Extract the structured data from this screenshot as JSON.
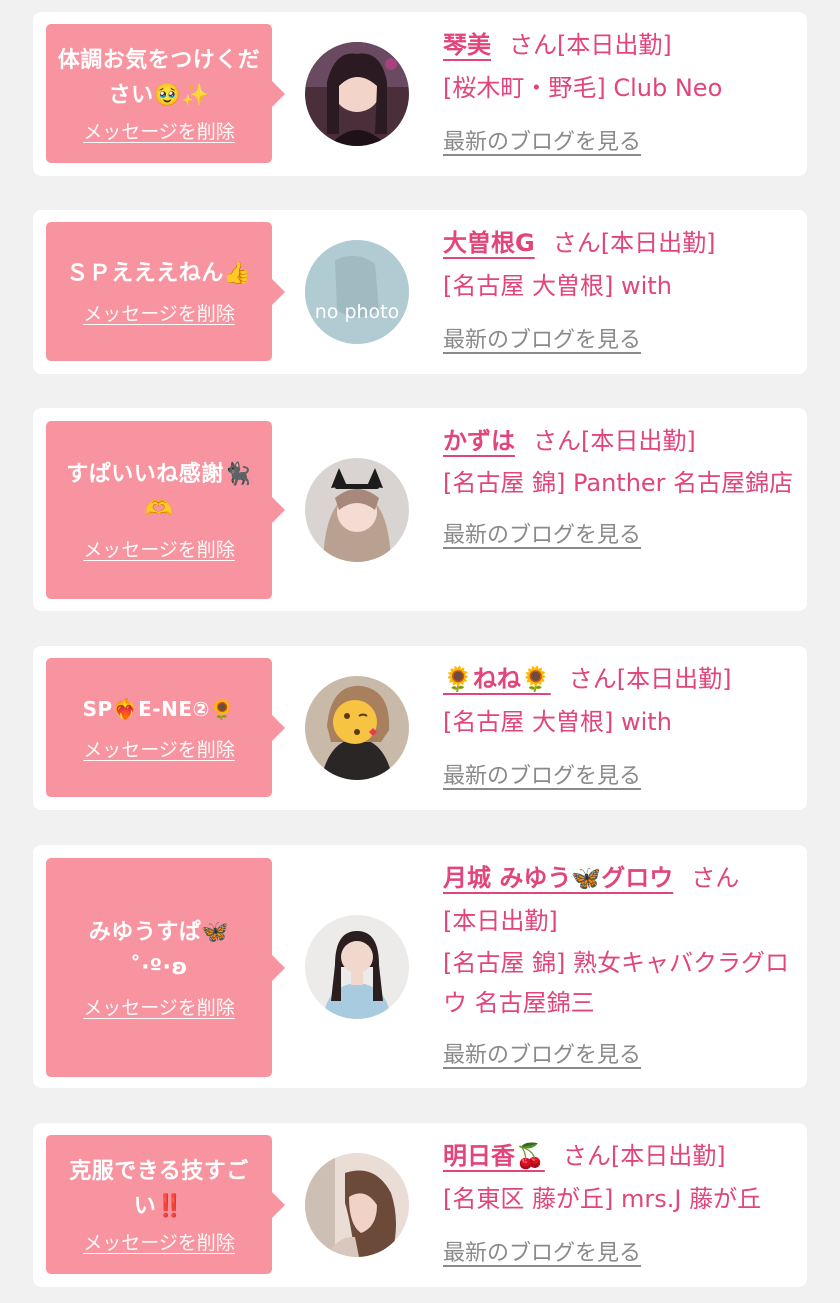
{
  "messages": [
    {
      "bubble": "体調お気をつけください🥹✨",
      "delete_label": "メッセージを削除",
      "avatar": "avatar-photo",
      "name": "琴美",
      "san": "さん",
      "status": "[本日出勤]",
      "shop": "[桜木町・野毛] Club Neo",
      "blog_label": "最新のブログを見る"
    },
    {
      "bubble": "ＳＰえええねん👍",
      "delete_label": "メッセージを削除",
      "avatar": "avatar-no-photo",
      "avatar_text": "no photo",
      "name": "大曽根G",
      "san": "さん",
      "status": "[本日出勤]",
      "shop": "[名古屋 大曽根] with",
      "blog_label": "最新のブログを見る"
    },
    {
      "bubble": "すぱいいね感謝🐈‍⬛🫶",
      "delete_label": "メッセージを削除",
      "avatar": "avatar-photo",
      "name": "かずは",
      "san": "さん",
      "status": "[本日出勤]",
      "shop": "[名古屋 錦] Panther 名古屋錦店",
      "blog_label": "最新のブログを見る"
    },
    {
      "bubble": "SP❤️‍🔥E-NE②🌻",
      "delete_label": "メッセージを削除",
      "avatar": "avatar-photo",
      "name": "🌻ねね🌻",
      "san": "さん",
      "status": "[本日出勤]",
      "shop": "[名古屋 大曽根] with",
      "blog_label": "最新のブログを見る"
    },
    {
      "bubble": "みゆうすぱ🦋 ˚‧º·ʚ",
      "delete_label": "メッセージを削除",
      "avatar": "avatar-photo",
      "name": "月城 みゆう🦋グロウ",
      "san": "さん",
      "status": "[本日出勤]",
      "shop": "[名古屋 錦] 熟女キャバクラグロウ 名古屋錦三",
      "blog_label": "最新のブログを見る"
    },
    {
      "bubble": "克服できる技すごい‼️",
      "delete_label": "メッセージを削除",
      "avatar": "avatar-photo",
      "name": "明日香🍒",
      "san": "さん",
      "status": "[本日出勤]",
      "shop": "[名東区 藤が丘] mrs.J 藤が丘",
      "blog_label": "最新のブログを見る"
    }
  ],
  "colors": {
    "page_bg": "#f1f1f1",
    "card_bg": "#ffffff",
    "bubble_bg": "#f8949f",
    "accent": "#e2447c",
    "blog_link": "#8a8a8a"
  }
}
